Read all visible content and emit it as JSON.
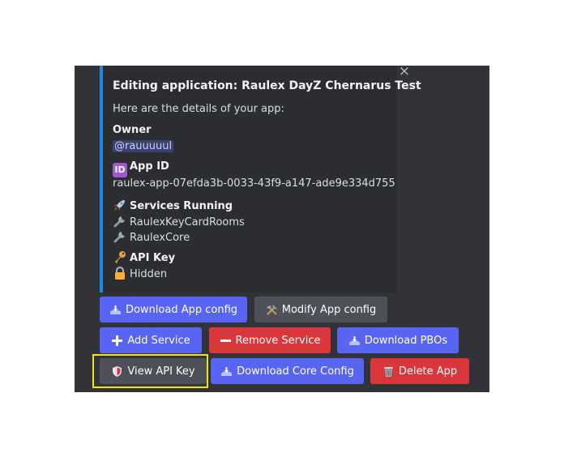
{
  "dialog": {
    "close_symbol": "×",
    "title": "Editing application: Raulex DayZ Chernarus Test",
    "intro": "Here are the details of your app:",
    "owner_heading": "Owner",
    "owner_value": "@rauuuuul",
    "app_id_badge": "ID",
    "app_id_heading": "App ID",
    "app_id_value": "raulex-app-07efda3b-0033-43f9-a147-ade9e334d755",
    "services_heading": "Services Running",
    "services": [
      "RaulexKeyCardRooms",
      "RaulexCore"
    ],
    "api_key_heading": "API Key",
    "api_key_value": "Hidden"
  },
  "icons": {
    "app_id": "id-badge-icon",
    "services": "rocket-icon",
    "service_item": "wrench-icon",
    "api_key": "key-icon",
    "api_key_status": "lock-icon"
  },
  "buttons": {
    "download_app_config": "Download App config",
    "modify_app_config": "Modify App config",
    "add_service": "Add Service",
    "remove_service": "Remove Service",
    "download_pbos": "Download PBOs",
    "view_api_key": "View API Key",
    "download_core_config": "Download Core Config",
    "delete_app": "Delete App"
  },
  "colors": {
    "primary": "#5865f2",
    "secondary": "#4e5058",
    "danger": "#da373c",
    "embed_accent": "#1e88e5",
    "highlight": "#f3e600"
  }
}
